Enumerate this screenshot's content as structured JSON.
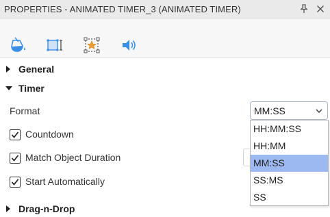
{
  "panel": {
    "title": "PROPERTIES - ANIMATED TIMER_3 (ANIMATED TIMER)",
    "pin_icon": "pin-icon",
    "close_icon": "close-icon"
  },
  "tabs": [
    {
      "icon": "fill-bucket-icon",
      "active": false
    },
    {
      "icon": "size-position-icon",
      "active": false
    },
    {
      "icon": "star-animation-icon",
      "active": true
    },
    {
      "icon": "speaker-icon",
      "active": false
    }
  ],
  "sections": {
    "general": {
      "label": "General",
      "expanded": false
    },
    "timer": {
      "label": "Timer",
      "expanded": true
    },
    "dragndrop": {
      "label": "Drag-n-Drop",
      "expanded": false
    }
  },
  "timer": {
    "format_label": "Format",
    "format_value": "MM:SS",
    "format_options": [
      "HH:MM:SS",
      "HH:MM",
      "MM:SS",
      "SS:MS",
      "SS"
    ],
    "countdown_label": "Countdown",
    "countdown_checked": true,
    "match_label": "Match Object Duration",
    "match_checked": true,
    "autostart_label": "Start Automatically",
    "autostart_checked": true
  },
  "colors": {
    "accent_blue": "#3a8ee6",
    "selected_option": "#9db9f1",
    "star_orange": "#f0a030"
  }
}
